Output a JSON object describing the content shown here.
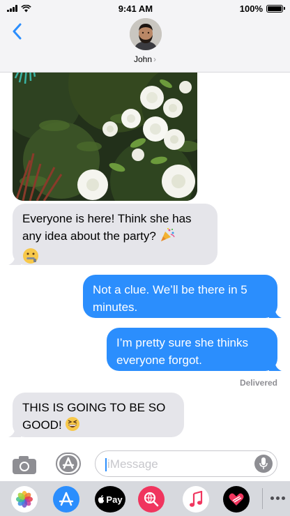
{
  "status_bar": {
    "time": "9:41 AM",
    "battery_percent": "100%",
    "battery_level": 1.0
  },
  "header": {
    "contact_name": "John",
    "chevron": "›"
  },
  "messages": [
    {
      "kind": "photo",
      "from": "contact",
      "subject": "white roses and party decorations"
    },
    {
      "kind": "text",
      "from": "contact",
      "line1": "Everyone is here! Think she has",
      "line2": "any idea about the party?",
      "emojis": [
        "party-popper-icon",
        "zipper-mouth-face-icon"
      ]
    },
    {
      "kind": "text",
      "from": "me",
      "line1": "Not a clue. We’ll be there in 5",
      "line2": "minutes."
    },
    {
      "kind": "text",
      "from": "me",
      "line1": "I’m pretty sure she thinks",
      "line2": "everyone forgot."
    },
    {
      "kind": "text",
      "from": "contact",
      "line1": "THIS IS GOING TO BE SO",
      "line2": "GOOD!",
      "emojis": [
        "grinning-squinting-face-icon"
      ]
    }
  ],
  "delivered_label": "Delivered",
  "input": {
    "placeholder": "iMessage"
  },
  "app_drawer": {
    "apps": [
      "photos-app-icon",
      "app-store-icon",
      "apple-pay-icon",
      "web-images-icon",
      "music-icon",
      "digital-touch-icon"
    ],
    "pay_label": "Pay"
  },
  "colors": {
    "sent_bubble": "#2b8efd",
    "received_bubble": "#e5e5ea",
    "accent": "#2b8efd",
    "header_bg": "#f4f4f6",
    "drawer_bg": "#d7d9de"
  }
}
